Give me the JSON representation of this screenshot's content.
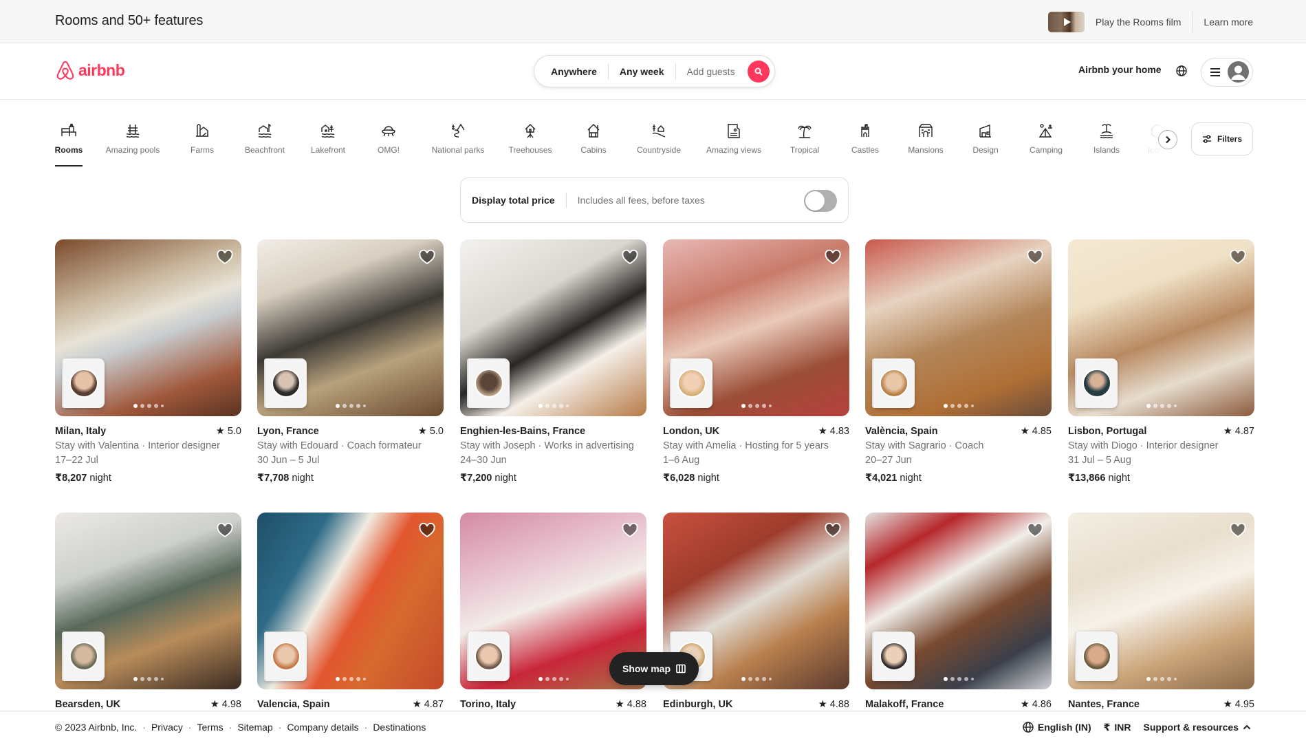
{
  "banner": {
    "title": "Rooms and 50+ features",
    "film_link": "Play the Rooms film",
    "learn_more": "Learn more"
  },
  "header": {
    "logo_text": "airbnb",
    "search": {
      "where": "Anywhere",
      "when": "Any week",
      "guests_placeholder": "Add guests"
    },
    "host_link": "Airbnb your home"
  },
  "categories": [
    {
      "label": "Rooms",
      "icon": "rooms-icon",
      "active": true
    },
    {
      "label": "Amazing pools",
      "icon": "pool-icon"
    },
    {
      "label": "Farms",
      "icon": "farm-icon"
    },
    {
      "label": "Beachfront",
      "icon": "beachfront-icon"
    },
    {
      "label": "Lakefront",
      "icon": "lakefront-icon"
    },
    {
      "label": "OMG!",
      "icon": "ufo-icon"
    },
    {
      "label": "National parks",
      "icon": "national-park-icon"
    },
    {
      "label": "Treehouses",
      "icon": "treehouse-icon"
    },
    {
      "label": "Cabins",
      "icon": "cabin-icon"
    },
    {
      "label": "Countryside",
      "icon": "countryside-icon"
    },
    {
      "label": "Amazing views",
      "icon": "views-icon"
    },
    {
      "label": "Tropical",
      "icon": "palm-icon"
    },
    {
      "label": "Castles",
      "icon": "castle-icon"
    },
    {
      "label": "Mansions",
      "icon": "mansion-icon"
    },
    {
      "label": "Design",
      "icon": "design-icon"
    },
    {
      "label": "Camping",
      "icon": "camping-icon"
    },
    {
      "label": "Islands",
      "icon": "island-icon"
    },
    {
      "label": "Icons",
      "icon": "icons-icon",
      "faded": true
    }
  ],
  "filters_label": "Filters",
  "total_price": {
    "title": "Display total price",
    "subtitle": "Includes all fees, before taxes",
    "enabled": false
  },
  "listings": [
    {
      "location": "Milan, Italy",
      "rating": "5.0",
      "host": "Stay with Valentina · Interior designer",
      "dates": "17–22 Jul",
      "price": "₹8,207",
      "unit": "night"
    },
    {
      "location": "Lyon, France",
      "rating": "5.0",
      "host": "Stay with Edouard · Coach formateur",
      "dates": "30 Jun – 5 Jul",
      "price": "₹7,708",
      "unit": "night"
    },
    {
      "location": "Enghien-les-Bains, France",
      "rating": "",
      "host": "Stay with Joseph · Works in advertising",
      "dates": "24–30 Jun",
      "price": "₹7,200",
      "unit": "night"
    },
    {
      "location": "London, UK",
      "rating": "4.83",
      "host": "Stay with Amelia · Hosting for 5 years",
      "dates": "1–6 Aug",
      "price": "₹6,028",
      "unit": "night"
    },
    {
      "location": "València, Spain",
      "rating": "4.85",
      "host": "Stay with Sagrario · Coach",
      "dates": "20–27 Jun",
      "price": "₹4,021",
      "unit": "night"
    },
    {
      "location": "Lisbon, Portugal",
      "rating": "4.87",
      "host": "Stay with Diogo · Interior designer",
      "dates": "31 Jul – 5 Aug",
      "price": "₹13,866",
      "unit": "night"
    },
    {
      "location": "Bearsden, UK",
      "rating": "4.98"
    },
    {
      "location": "Valencia, Spain",
      "rating": "4.87"
    },
    {
      "location": "Torino, Italy",
      "rating": "4.88"
    },
    {
      "location": "Edinburgh, UK",
      "rating": "4.88"
    },
    {
      "location": "Malakoff, France",
      "rating": "4.86"
    },
    {
      "location": "Nantes, France",
      "rating": "4.95"
    }
  ],
  "show_map_label": "Show map",
  "footer": {
    "copyright": "© 2023 Airbnb, Inc.",
    "links": [
      "Privacy",
      "Terms",
      "Sitemap",
      "Company details",
      "Destinations"
    ],
    "language": "English (IN)",
    "currency_symbol": "₹",
    "currency": "INR",
    "support": "Support & resources"
  },
  "colors": {
    "brand": "#ff385c",
    "text": "#222222",
    "muted": "#717171"
  }
}
